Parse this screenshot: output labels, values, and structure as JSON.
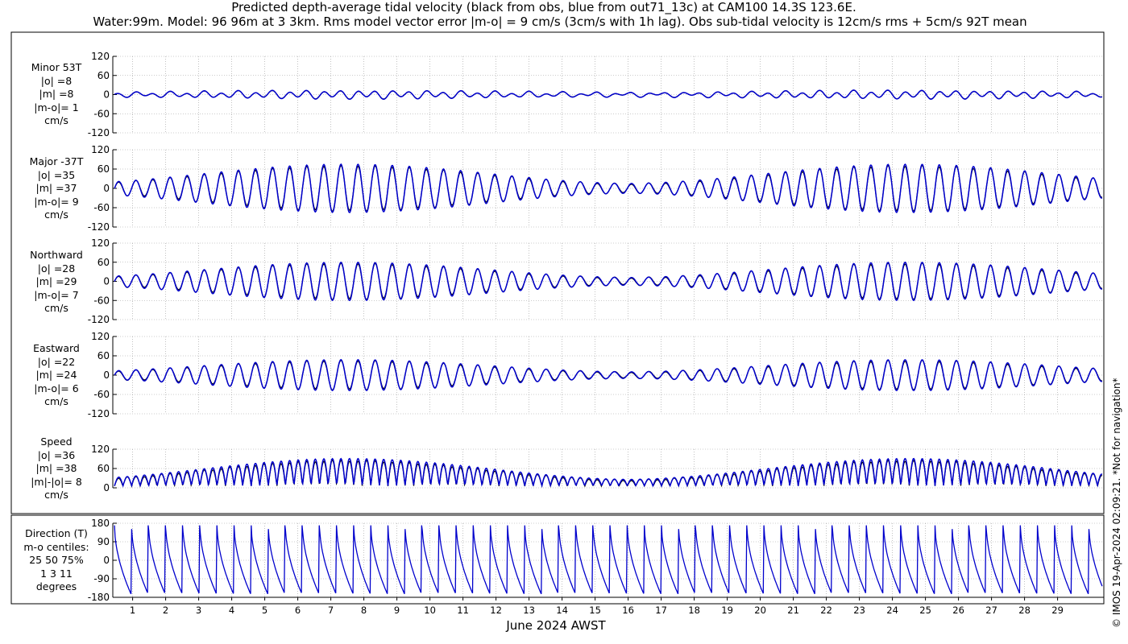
{
  "header": {
    "line1": "Predicted depth-average tidal velocity (black from obs, blue from out71_13c) at CAM100 14.3S 123.6E.",
    "line2": "Water:99m. Model: 96 96m at 3 3km. Rms model vector error |m-o| = 9 cm/s (3cm/s with 1h lag). Obs sub-tidal velocity is 12cm/s rms + 5cm/s 92T mean"
  },
  "copyright": "© IMOS 19-Apr-2024 02:09:21. *Not for navigation*",
  "colors": {
    "model": "#0000cc",
    "obs": "#000000",
    "grid": "#999999"
  },
  "chart_data": {
    "type": "line",
    "xlabel": "June 2024 AWST",
    "x_ticks": [
      1,
      2,
      3,
      4,
      5,
      6,
      7,
      8,
      9,
      10,
      11,
      12,
      13,
      14,
      15,
      16,
      17,
      18,
      19,
      20,
      21,
      22,
      23,
      24,
      25,
      26,
      27,
      28,
      29
    ],
    "xlim": [
      0.4,
      30.4
    ],
    "panels": [
      {
        "name": "minor",
        "label_lines": [
          "Minor 53T",
          "|o| =8",
          "|m| =8",
          "|m-o|= 1",
          "cm/s"
        ],
        "ylim": [
          -120,
          120
        ],
        "yticks": [
          "120",
          "60",
          "0",
          "-60",
          "-120"
        ],
        "amplitude_cm_s": [
          8,
          18
        ]
      },
      {
        "name": "major",
        "label_lines": [
          "Major -37T",
          "|o| =35",
          "|m| =37",
          "|m-o|= 9",
          "cm/s"
        ],
        "ylim": [
          -120,
          120
        ],
        "yticks": [
          "120",
          "60",
          "0",
          "-60",
          "-120"
        ],
        "amplitude_cm_s": [
          15,
          75
        ]
      },
      {
        "name": "northward",
        "label_lines": [
          "Northward",
          "|o| =28",
          "|m| =29",
          "|m-o|= 7",
          "cm/s"
        ],
        "ylim": [
          -120,
          120
        ],
        "yticks": [
          "120",
          "60",
          "0",
          "-60",
          "-120"
        ],
        "amplitude_cm_s": [
          12,
          60
        ]
      },
      {
        "name": "eastward",
        "label_lines": [
          "Eastward",
          "|o| =22",
          "|m| =24",
          "|m-o|= 6",
          "cm/s"
        ],
        "ylim": [
          -120,
          120
        ],
        "yticks": [
          "120",
          "60",
          "0",
          "-60",
          "-120"
        ],
        "amplitude_cm_s": [
          10,
          48
        ]
      },
      {
        "name": "speed",
        "label_lines": [
          "Speed",
          "|o| =36",
          "|m| =38",
          "|m|-|o|= 8",
          "cm/s"
        ],
        "ylim": [
          0,
          120
        ],
        "yticks": [
          "120",
          "60",
          "0"
        ],
        "amplitude_cm_s": [
          20,
          85
        ]
      },
      {
        "name": "direction",
        "label_lines": [
          "Direction (T)",
          "m-o centiles:",
          "25  50  75%",
          "1   3  11",
          "degrees"
        ],
        "ylim": [
          -180,
          180
        ],
        "yticks": [
          "180",
          "90",
          "0",
          "-90",
          "-180"
        ]
      }
    ],
    "spring_tides_day": [
      7.5,
      24.5
    ],
    "neap_tides_day": [
      16.3
    ],
    "semidiurnal_period_h": 12.42
  }
}
